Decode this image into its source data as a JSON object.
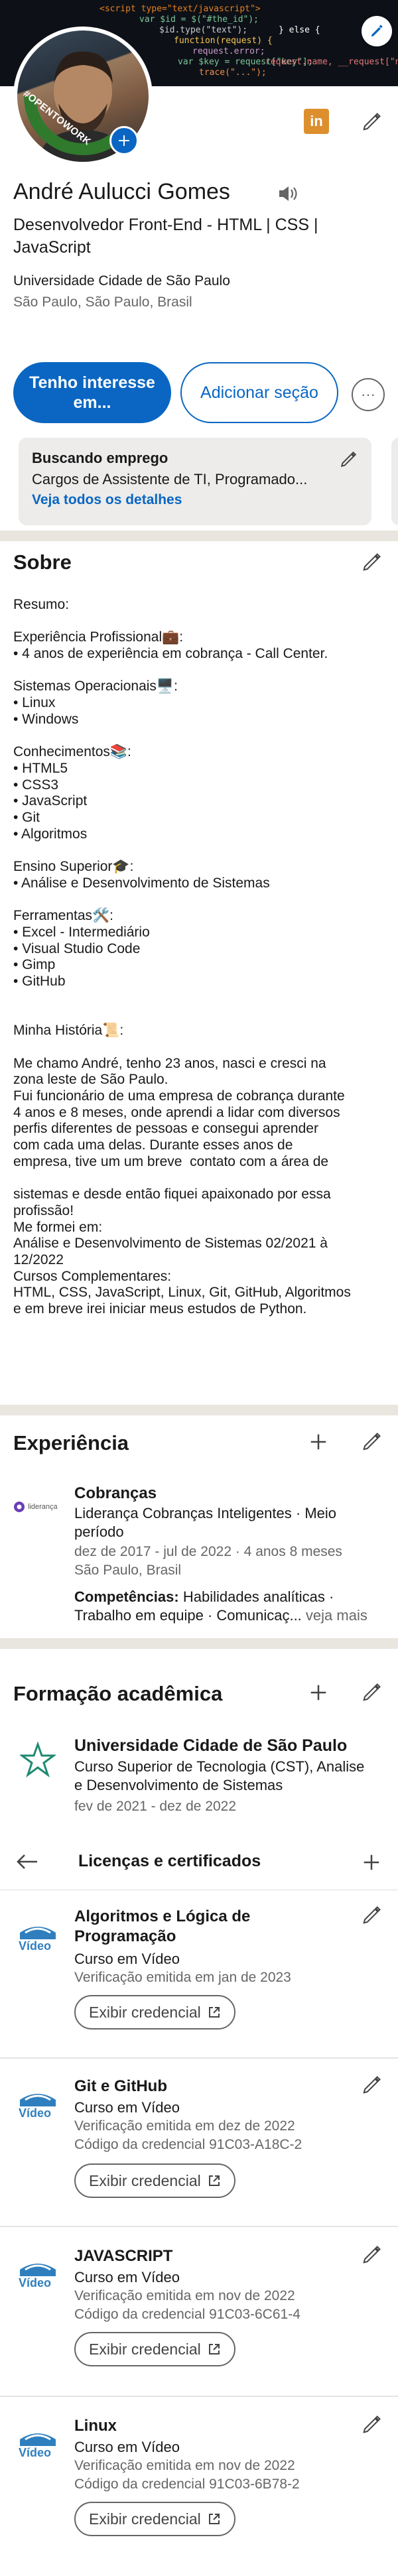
{
  "banner": {
    "code_lines": [
      "<script type=\"text/javascript\">",
      "var $id = $(\"#the_id\");",
      "$id.type(\"text\");",
      "function(request) {",
      "request.error;",
      "var $key = request[\"key\"];",
      "trace(\"...\");",
      "} else {",
      "request.name, __request[\"name\"]"
    ],
    "edit_icon": "pencil-icon"
  },
  "profile": {
    "open_to_work_label": "#OPENTOWORK",
    "name": "André Aulucci Gomes",
    "headline": "Desenvolvedor Front-End - HTML | CSS | JavaScript",
    "education": "Universidade Cidade de São Paulo",
    "location": "São Paulo, São Paulo, Brasil",
    "linkedin_badge": "in"
  },
  "actions": {
    "primary": "Tenho interesse em...",
    "secondary": "Adicionar seção",
    "more": "···"
  },
  "open_to_work": {
    "title": "Buscando emprego",
    "roles": "Cargos de Assistente de TI, Programado...",
    "link": "Veja todos os detalhes"
  },
  "about": {
    "title": "Sobre",
    "lines": [
      "Resumo:",
      "",
      "Experiência Profissional💼:",
      "• 4 anos de experiência em cobrança - Call Center.",
      "",
      "Sistemas Operacionais🖥️:",
      "• Linux",
      "• Windows",
      "",
      "Conhecimentos📚:",
      "• HTML5",
      "• CSS3",
      "• JavaScript",
      "• Git",
      "• Algoritmos",
      "",
      "Ensino Superior🎓:",
      "• Análise e Desenvolvimento de Sistemas",
      "",
      "Ferramentas🛠️:",
      "• Excel - Intermediário",
      "• Visual Studio Code",
      "• Gimp",
      "• GitHub",
      "",
      "",
      "Minha História📜:",
      "",
      "Me chamo André, tenho 23 anos, nasci e cresci na",
      "zona leste de São Paulo.",
      "Fui funcionário de uma empresa de cobrança durante",
      "4 anos e 8 meses, onde aprendi a lidar com diversos",
      "perfis diferentes de pessoas e consegui aprender",
      "com cada uma delas. Durante esses anos de",
      "empresa, tive um um breve  contato com a área de",
      "",
      "sistemas e desde então fiquei apaixonado por essa",
      "profissão!",
      "Me formei em:",
      "Análise e Desenvolvimento de Sistemas 02/2021 à",
      "12/2022",
      "Cursos Complementares:",
      "HTML, CSS, JavaScript, Linux, Git, GitHub, Algoritmos",
      "e em breve irei iniciar meus estudos de Python."
    ]
  },
  "experience": {
    "title": "Experiência",
    "items": [
      {
        "role": "Cobranças",
        "company": "Liderança Cobranças Inteligentes · Meio",
        "company_cont": "período",
        "dates": "dez de 2017 - jul de 2022 · 4 anos 8 meses",
        "location": "São Paulo, Brasil",
        "skills_label": "Competências:",
        "skills": "Habilidades analíticas ·",
        "skills_cont": "Trabalho em equipe · Comunicaç...",
        "more": "veja mais",
        "logo_text": "liderança"
      }
    ]
  },
  "education": {
    "title": "Formação acadêmica",
    "items": [
      {
        "school": "Universidade Cidade de São Paulo",
        "degree": "Curso Superior de Tecnologia (CST), Analise",
        "degree_cont": "e Desenvolvimento de Sistemas",
        "dates": "fev de 2021 - dez de 2022"
      }
    ]
  },
  "licenses": {
    "title": "Licenças e certificados",
    "back_icon": "arrow-left-icon",
    "items": [
      {
        "title": "Algoritmos e Lógica de",
        "title_cont": "Programação",
        "issuer": "Curso em Vídeo",
        "issued": "Verificação emitida em jan de 2023",
        "credential": "",
        "button": "Exibir credencial"
      },
      {
        "title": "Git e GitHub",
        "title_cont": "",
        "issuer": "Curso em Vídeo",
        "issued": "Verificação emitida em dez de 2022",
        "credential": "Código da credencial 91C03-A18C-2",
        "button": "Exibir credencial"
      },
      {
        "title": "JAVASCRIPT",
        "title_cont": "",
        "issuer": "Curso em Vídeo",
        "issued": "Verificação emitida em nov de 2022",
        "credential": "Código da credencial 91C03-6C61-4",
        "button": "Exibir credencial"
      },
      {
        "title": "Linux",
        "title_cont": "",
        "issuer": "Curso em Vídeo",
        "issued": "Verificação emitida em nov de 2022",
        "credential": "Código da credencial 91C03-6B78-2",
        "button": "Exibir credencial"
      }
    ],
    "logo_caption": "Vídeo"
  },
  "colors": {
    "brand_blue": "#0a66c2",
    "otw_green": "#2f7a2c",
    "divider": "#e9e5df",
    "muted": "#666666"
  }
}
